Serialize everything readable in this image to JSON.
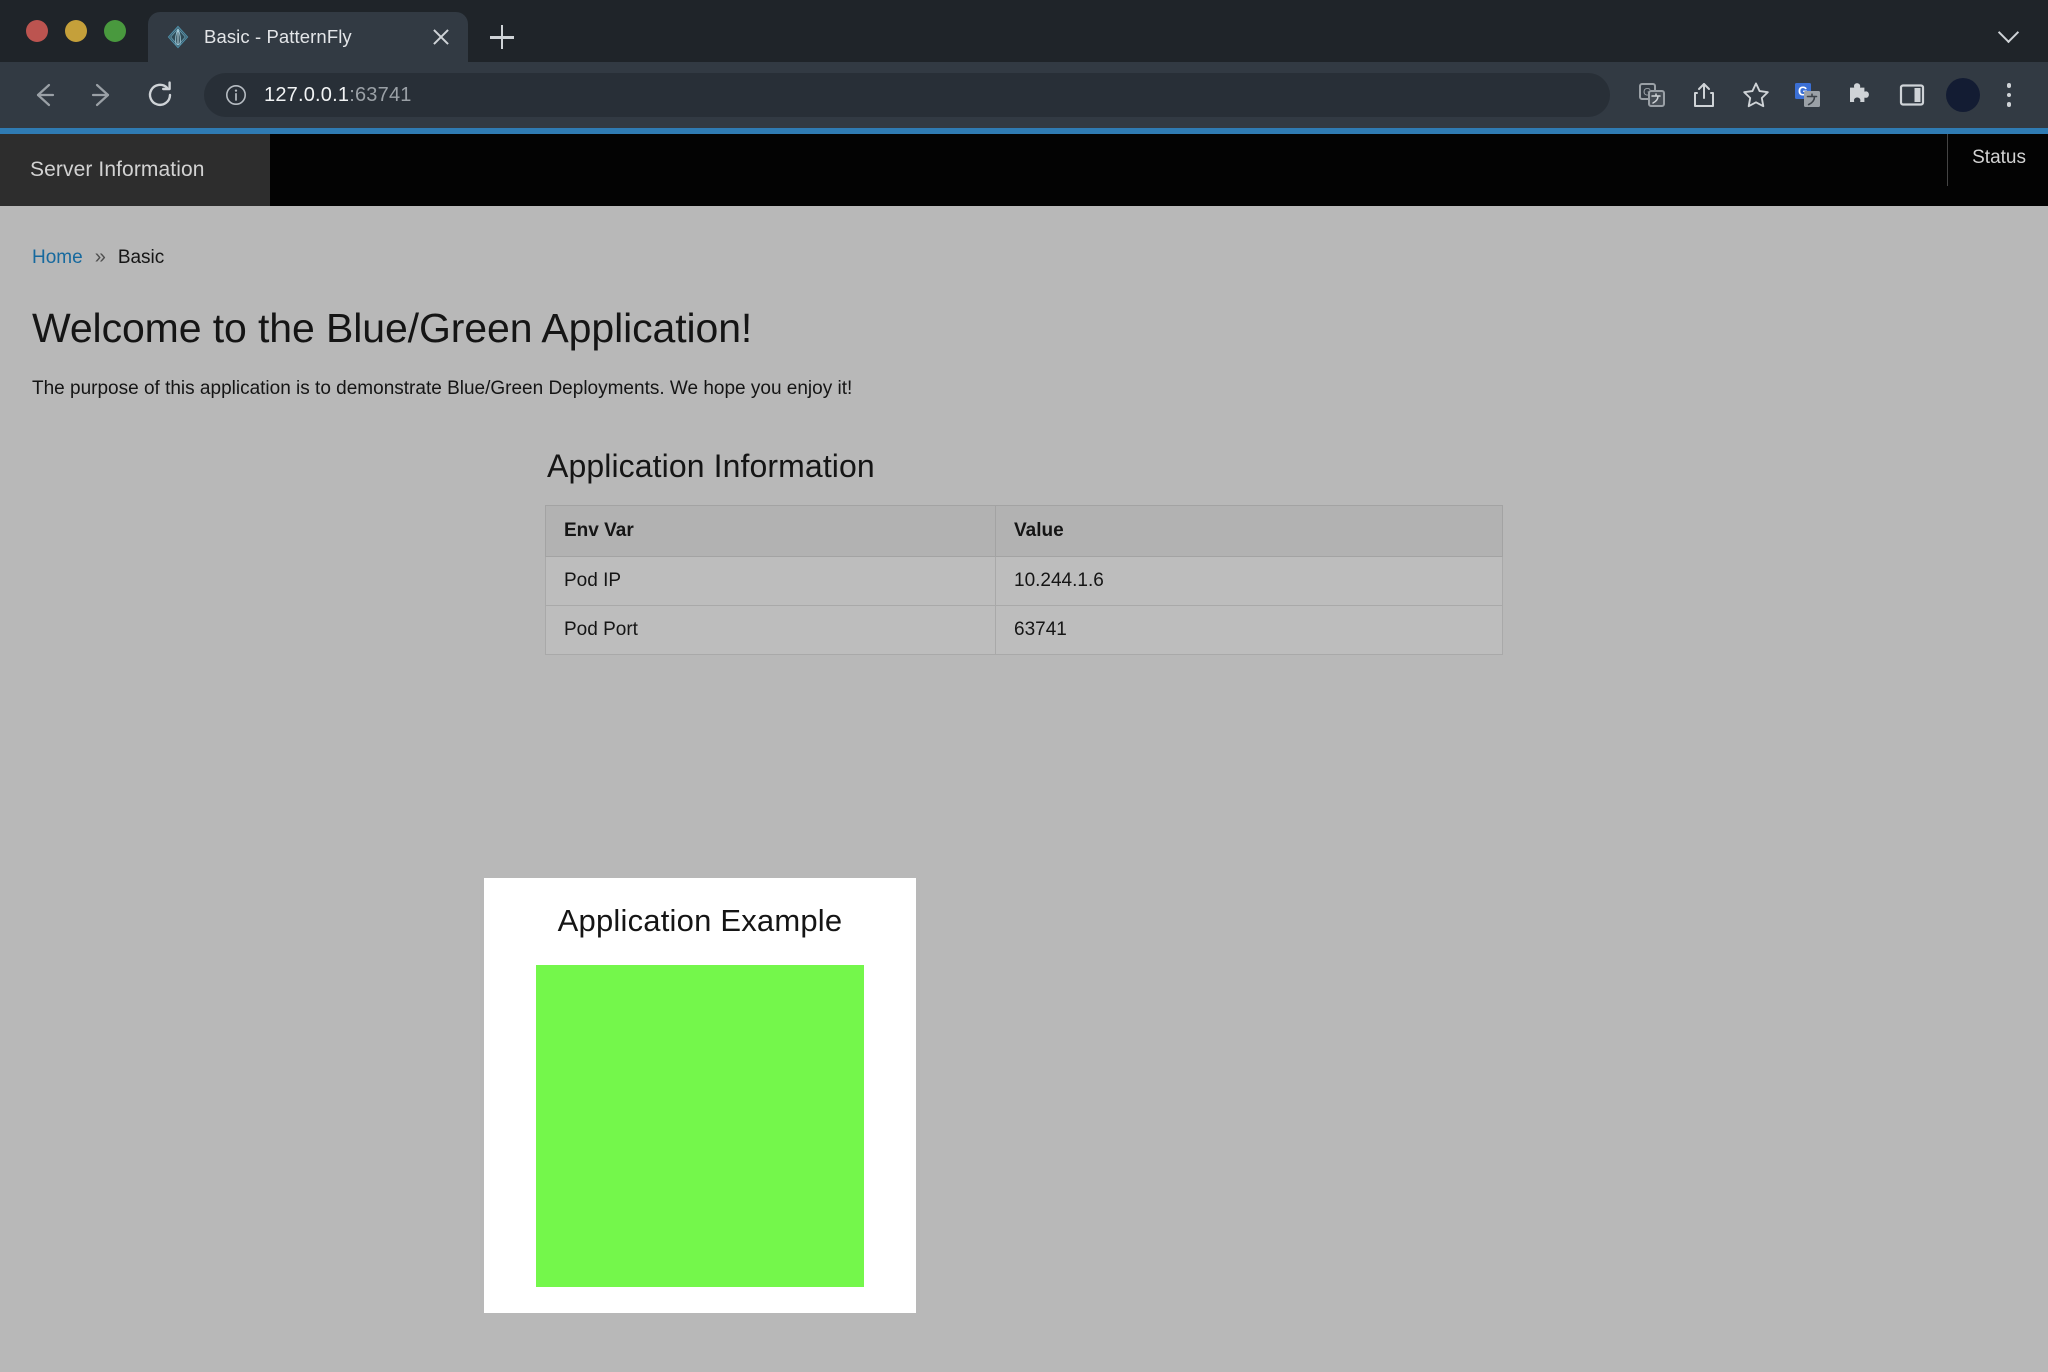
{
  "browser": {
    "window_controls": [
      "close",
      "minimize",
      "maximize"
    ],
    "tab": {
      "title": "Basic - PatternFly",
      "favicon": "patternfly-logo-icon",
      "close_label": "×"
    },
    "new_tab_label": "+",
    "tab_list_label": "v",
    "toolbar": {
      "back_label": "Back",
      "forward_label": "Forward",
      "reload_label": "Reload",
      "url_host": "127.0.0.1",
      "url_port": ":63741",
      "url_full": "127.0.0.1:63741",
      "site_info_icon": "info-circle-icon",
      "icons": [
        "translate-icon",
        "share-icon",
        "bookmark-star-icon",
        "google-translate-extension-icon",
        "extensions-puzzle-icon",
        "side-panel-icon"
      ],
      "profile_label": "Profile",
      "menu_label": "Customize and control"
    }
  },
  "page": {
    "accent_color": "#2f7bb3",
    "background_color": "#b8b8b8",
    "masthead": {
      "brand": "Server Information",
      "status": "Status"
    },
    "breadcrumb": {
      "home": "Home",
      "separator": "»",
      "current": "Basic"
    },
    "title": "Welcome to the Blue/Green Application!",
    "subtitle": "The purpose of this application is to demonstrate Blue/Green Deployments. We hope you enjoy it!",
    "app_info": {
      "heading": "Application Information",
      "columns": [
        "Env Var",
        "Value"
      ],
      "rows": [
        {
          "env_var": "Pod IP",
          "value": "10.244.1.6"
        },
        {
          "env_var": "Pod Port",
          "value": "63741"
        }
      ]
    },
    "example": {
      "heading": "Application Example",
      "swatch_color": "#74f74b",
      "card_background": "#ffffff"
    }
  }
}
